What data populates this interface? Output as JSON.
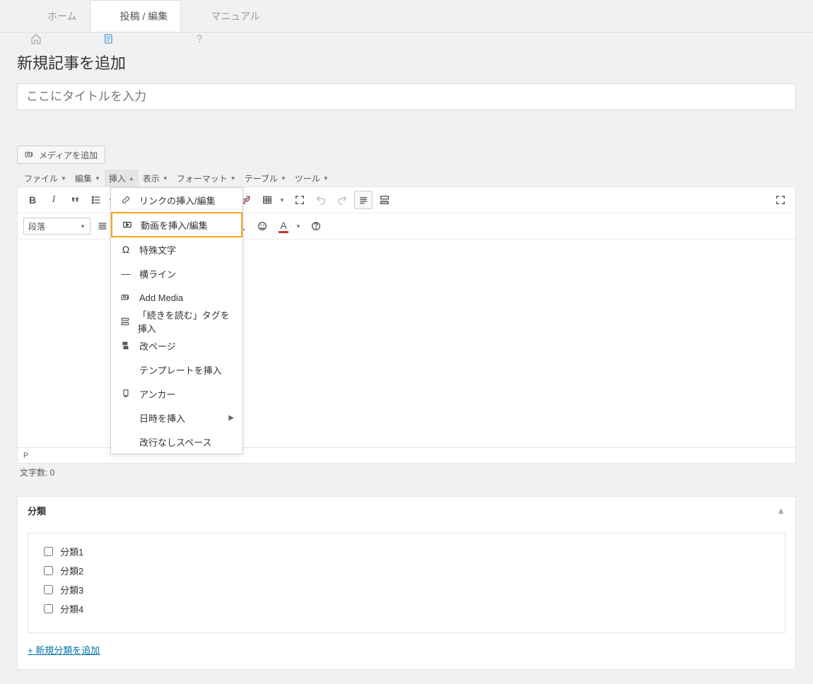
{
  "tabs": {
    "home": "ホーム",
    "post": "投稿 / 編集",
    "manual": "マニュアル"
  },
  "page_title": "新規記事を追加",
  "title_placeholder": "ここにタイトルを入力",
  "media_button": "メディアを追加",
  "menubar": {
    "file": "ファイル",
    "edit": "編集",
    "insert": "挿入",
    "view": "表示",
    "format": "フォーマット",
    "table": "テーブル",
    "tool": "ツール"
  },
  "paragraph_select": "段落",
  "toolbar_icons": {
    "bold": "bold-icon",
    "italic": "italic-icon",
    "quote": "quote-icon",
    "ul": "bullet-list-icon",
    "ol": "numbered-list-icon",
    "alignleft": "align-left-icon",
    "aligncenter": "align-center-icon",
    "alignright": "align-right-icon",
    "link": "link-icon",
    "unlink": "unlink-icon",
    "table": "table-icon",
    "fullscreen": "expand-icon",
    "undo": "undo-icon",
    "redo": "redo-icon",
    "pre": "preformatted-icon",
    "readmore": "read-more-icon",
    "hr": "horizontal-rule-icon",
    "clear": "clear-format-icon",
    "emoji": "emoji-icon",
    "color": "text-color-icon",
    "help": "help-icon",
    "fs2": "fullscreen-icon"
  },
  "dropdown": {
    "link": "リンクの挿入/編集",
    "video": "動画を挿入/編集",
    "special": "特殊文字",
    "hr": "横ライン",
    "media": "Add Media",
    "readmore": "「続きを読む」タグを挿入",
    "pagebreak": "改ページ",
    "template": "テンプレートを挿入",
    "anchor": "アンカー",
    "datetime": "日時を挿入",
    "nbsp": "改行なしスペース"
  },
  "status_path": "P",
  "char_count": "文字数: 0",
  "category": {
    "title": "分類",
    "items": [
      "分類1",
      "分類2",
      "分類3",
      "分類4"
    ],
    "add_new": "+ 新規分類を追加"
  }
}
